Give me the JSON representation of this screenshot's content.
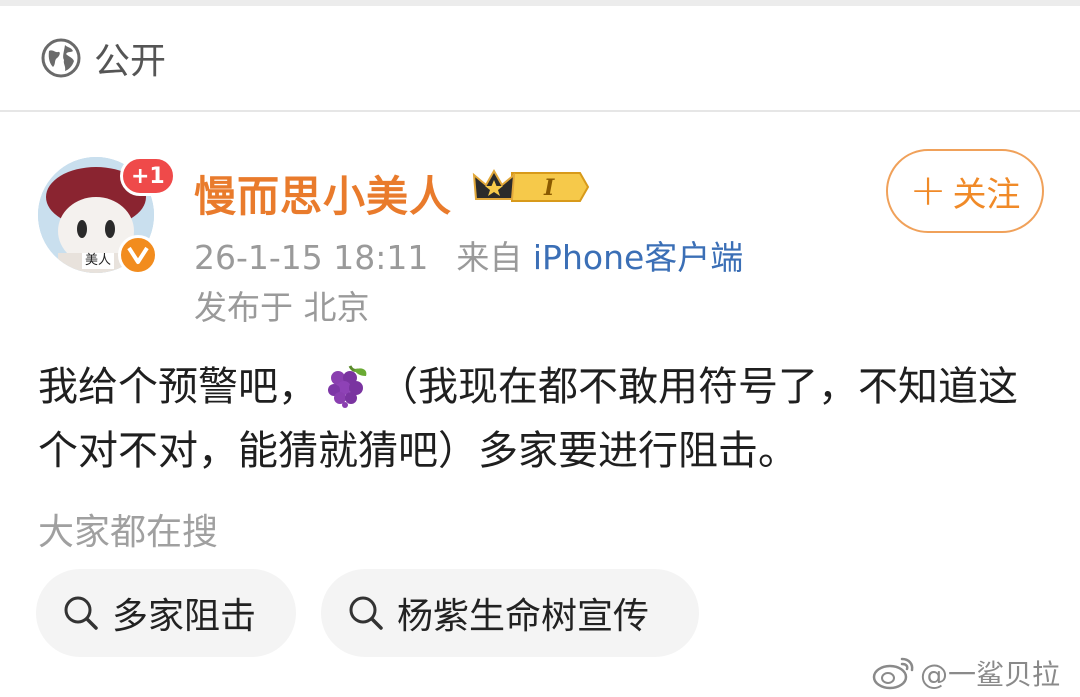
{
  "visibility": {
    "label": "公开",
    "icon": "globe-icon"
  },
  "post": {
    "author": {
      "name": "慢而思小美人",
      "avatar_tag": "美人",
      "notification_badge": "+1",
      "verified_icon": "verified-v-icon",
      "vip_icon": "crown-level-icon",
      "vip_level": "I"
    },
    "follow_button": {
      "label": "关注",
      "icon": "plus-icon"
    },
    "meta": {
      "timestamp": "26-1-15 18:11",
      "source_prefix": "来自",
      "source": "iPhone客户端",
      "location": "发布于 北京"
    },
    "text_before_emoji": "我给个预警吧，",
    "emoji": "grape-icon",
    "text_after_emoji": "（我现在都不敢用符号了，不知道这个对不对，能猜就猜吧）多家要进行阻击。"
  },
  "search": {
    "heading": "大家都在搜",
    "chips": [
      {
        "label": "多家阻击",
        "icon": "search-icon"
      },
      {
        "label": "杨紫生命树宣传",
        "icon": "search-icon"
      }
    ]
  },
  "watermark": {
    "text": "@一鲨贝拉",
    "icon": "weibo-logo-icon"
  },
  "colors": {
    "username": "#e97b2c",
    "follow": "#f08a28",
    "source_link": "#3b6fb6",
    "badge_red": "#ef4a4a",
    "verified_orange": "#f28c1e"
  }
}
